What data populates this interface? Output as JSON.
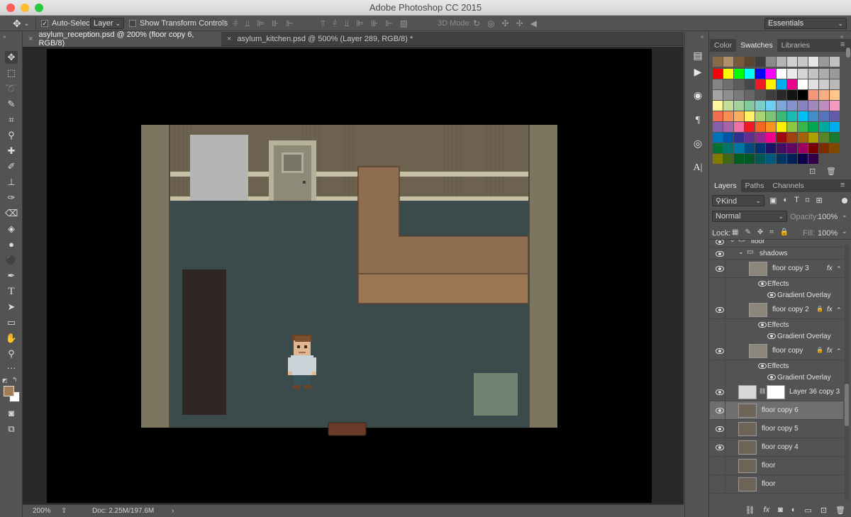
{
  "window": {
    "title": "Adobe Photoshop CC 2015"
  },
  "options_bar": {
    "auto_select_label": "Auto-Select:",
    "auto_select_checked": true,
    "auto_select_value": "Layer",
    "transform_label": "Show Transform Controls",
    "transform_checked": false,
    "mode3d_label": "3D Mode:",
    "workspace": "Essentials"
  },
  "tabs": [
    {
      "label": "asylum_reception.psd @ 200% (floor copy 6, RGB/8)",
      "active": true
    },
    {
      "label": "asylum_kitchen.psd @ 500% (Layer 289, RGB/8) *",
      "active": false
    }
  ],
  "status": {
    "zoom": "200%",
    "doc": "Doc: 2.25M/197.6M"
  },
  "colors": {
    "foreground": "#a07d55",
    "background": "#ffffff"
  },
  "swatches_panel": {
    "tabs": [
      "Color",
      "Swatches",
      "Libraries"
    ],
    "active_tab": "Swatches",
    "recent": [
      "#8b6a4a",
      "#b0906a",
      "#7a5a3c",
      "#5b4632",
      "#3e3e3e",
      "#8a8a8a",
      "#b4b4b4",
      "#d0d0d0",
      "#c8c8c8",
      "#e6e6e6",
      "#9a9a9a",
      "#c0c0c0"
    ],
    "grid": [
      "#ff0000",
      "#ffff00",
      "#00ff00",
      "#00ffff",
      "#0000ff",
      "#ff00ff",
      "#ffffff",
      "#ebebeb",
      "#d6d6d6",
      "#c2c2c2",
      "#adadad",
      "#999999",
      "#858585",
      "#707070",
      "#5c5c5c",
      "#474747",
      "#ed1c24",
      "#fff200",
      "#00aeef",
      "#ec008c",
      "#ffffff",
      "#e0e0e0",
      "#cccccc",
      "#b8b8b8",
      "#a3a3a3",
      "#8f8f8f",
      "#7a7a7a",
      "#666666",
      "#525252",
      "#3d3d3d",
      "#292929",
      "#141414",
      "#000000",
      "#f7977a",
      "#f9ad81",
      "#fdc68a",
      "#fff79a",
      "#c4df9b",
      "#a2d39c",
      "#82ca9d",
      "#7bcdc8",
      "#6ecff6",
      "#7ea7d8",
      "#8493ca",
      "#8882be",
      "#a187be",
      "#bc8dbf",
      "#f49ac2",
      "#f26c4f",
      "#f68e55",
      "#fbaf5c",
      "#fff467",
      "#acd372",
      "#7cc576",
      "#3bb878",
      "#1abbb4",
      "#00bff3",
      "#438ccb",
      "#5574b9",
      "#605ca8",
      "#855fa8",
      "#a763a8",
      "#f06ea9",
      "#ed1c24",
      "#f26522",
      "#f7941d",
      "#fff200",
      "#8dc73f",
      "#39b54a",
      "#00a651",
      "#00a99d",
      "#00aeef",
      "#0072bc",
      "#0054a6",
      "#2e3192",
      "#662d91",
      "#92278f",
      "#ec008c",
      "#9e0b0f",
      "#a0410d",
      "#a36209",
      "#aba000",
      "#598527",
      "#1a7b30",
      "#007236",
      "#00746b",
      "#0076a3",
      "#004b80",
      "#003471",
      "#1b1464",
      "#440e62",
      "#630460",
      "#9e005d",
      "#790000",
      "#7b2e00",
      "#7d4900",
      "#827b00",
      "#406618",
      "#005e20",
      "#005826",
      "#005952",
      "#005b7f",
      "#003663",
      "#002157",
      "#0d004c",
      "#32004b"
    ]
  },
  "layers_panel": {
    "tabs": [
      "Layers",
      "Paths",
      "Channels"
    ],
    "active_tab": "Layers",
    "kind_label": "Kind",
    "blend_mode": "Normal",
    "opacity_label": "Opacity:",
    "opacity": "100%",
    "lock_label": "Lock:",
    "fill_label": "Fill:",
    "fill": "100%",
    "rows": [
      {
        "name": "floor",
        "kind": "group",
        "indent": 0,
        "visible": true,
        "cut": true
      },
      {
        "name": "shadows",
        "kind": "group",
        "indent": 1,
        "visible": true
      },
      {
        "name": "floor copy 3",
        "kind": "layer",
        "indent": 2,
        "visible": true,
        "fx": true,
        "locked": false
      },
      {
        "name": "Effects",
        "kind": "effects",
        "indent": 3,
        "visible": true
      },
      {
        "name": "Gradient Overlay",
        "kind": "effect",
        "indent": 4,
        "visible": true
      },
      {
        "name": "floor copy 2",
        "kind": "layer",
        "indent": 2,
        "visible": true,
        "fx": true,
        "locked": true
      },
      {
        "name": "Effects",
        "kind": "effects",
        "indent": 3,
        "visible": true
      },
      {
        "name": "Gradient Overlay",
        "kind": "effect",
        "indent": 4,
        "visible": true
      },
      {
        "name": "floor copy",
        "kind": "layer",
        "indent": 2,
        "visible": true,
        "fx": true,
        "locked": true
      },
      {
        "name": "Effects",
        "kind": "effects",
        "indent": 3,
        "visible": true
      },
      {
        "name": "Gradient Overlay",
        "kind": "effect",
        "indent": 4,
        "visible": true
      },
      {
        "name": "Layer 36 copy 3",
        "kind": "masked",
        "indent": 1,
        "visible": true
      },
      {
        "name": "floor copy 6",
        "kind": "layer",
        "indent": 1,
        "visible": true,
        "selected": true
      },
      {
        "name": "floor copy 5",
        "kind": "layer",
        "indent": 1,
        "visible": true
      },
      {
        "name": "floor copy 4",
        "kind": "layer",
        "indent": 1,
        "visible": true
      },
      {
        "name": "floor",
        "kind": "layer",
        "indent": 1,
        "visible": false
      },
      {
        "name": "floor",
        "kind": "layer",
        "indent": 1,
        "visible": false
      }
    ]
  },
  "icons": {
    "move": "move-icon",
    "marquee": "marquee-icon",
    "lasso": "lasso-icon",
    "quick-select": "quick-select-icon",
    "crop": "crop-icon",
    "eyedropper": "eyedropper-icon",
    "healing": "healing-brush-icon",
    "brush": "brush-icon",
    "stamp": "clone-stamp-icon",
    "history-brush": "history-brush-icon",
    "eraser": "eraser-icon",
    "bucket": "paint-bucket-icon",
    "blur": "blur-icon",
    "dodge": "dodge-icon",
    "pen": "pen-icon",
    "type": "type-icon",
    "path-select": "path-selection-icon",
    "shape": "rectangle-shape-icon",
    "hand": "hand-icon",
    "zoom": "zoom-icon"
  }
}
